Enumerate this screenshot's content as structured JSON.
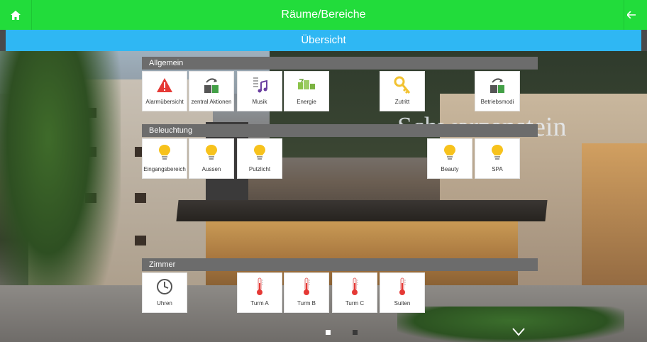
{
  "header": {
    "title": "Räume/Bereiche",
    "subtitle": "Übersicht"
  },
  "colors": {
    "topbar": "#22dc3b",
    "subbar": "#2fb7f3",
    "section": "#6c6c6c"
  },
  "background_sign": "Schwarzenstein",
  "sections": {
    "allgemein": {
      "title": "Allgemein",
      "tiles": [
        {
          "label": "Alarmübersicht",
          "icon": "warning-icon"
        },
        {
          "label": "zentral Aktionen",
          "icon": "building-arrow-icon"
        },
        {
          "label": "Musik",
          "icon": "music-icon"
        },
        {
          "label": "Energie",
          "icon": "energy-icon"
        },
        {
          "label": "Zutritt",
          "icon": "key-icon"
        },
        {
          "label": "Betriebsmodi",
          "icon": "building-arrow-icon"
        }
      ]
    },
    "beleuchtung": {
      "title": "Beleuchtung",
      "tiles": [
        {
          "label": "Eingangsbereich",
          "icon": "bulb-icon"
        },
        {
          "label": "Aussen",
          "icon": "bulb-icon"
        },
        {
          "label": "Putzlicht",
          "icon": "bulb-icon"
        },
        {
          "label": "Beauty",
          "icon": "bulb-icon"
        },
        {
          "label": "SPA",
          "icon": "bulb-icon"
        }
      ]
    },
    "zimmer": {
      "title": "Zimmer",
      "tiles": [
        {
          "label": "Uhren",
          "icon": "clock-icon"
        },
        {
          "label": "Turm A",
          "icon": "thermometer-icon"
        },
        {
          "label": "Turm B",
          "icon": "thermometer-icon"
        },
        {
          "label": "Turm C",
          "icon": "thermometer-icon"
        },
        {
          "label": "Suiten",
          "icon": "thermometer-icon"
        }
      ]
    }
  },
  "pager": {
    "pages": 2,
    "active": 1
  }
}
